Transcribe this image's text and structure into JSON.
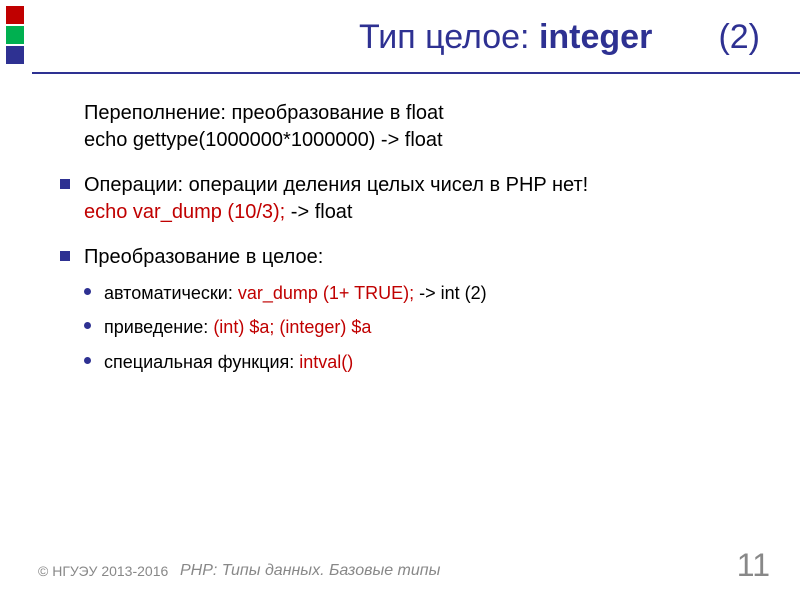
{
  "title": {
    "prefix": "Тип целое: ",
    "bold": "integer",
    "suffix": "(2)"
  },
  "bullets": [
    {
      "style": "none",
      "line1_a": "Переполнение: преобразование в float",
      "line2_a": "echo gettype(1000000*1000000)  -> float"
    },
    {
      "style": "square",
      "line1_a": "Операции: операции деления целых чисел в PHP нет!",
      "line2_red": "echo var_dump (10/3);",
      "line2_b": "        -> float"
    },
    {
      "style": "square",
      "line1_a": "Преобразование в целое:",
      "sub": [
        {
          "a": " автоматически: ",
          "red": "var_dump (1+ TRUE);",
          "b": "   -> int (2)"
        },
        {
          "a": "приведение: ",
          "red": "(int) $a; (integer) $a",
          "b": ""
        },
        {
          "a": "специальная функция: ",
          "red": "intval()",
          "b": ""
        }
      ]
    }
  ],
  "footer": {
    "copyright": "© НГУЭУ 2013-2016",
    "subtitle": "PHP: Типы данных. Базовые типы"
  },
  "page": "11"
}
